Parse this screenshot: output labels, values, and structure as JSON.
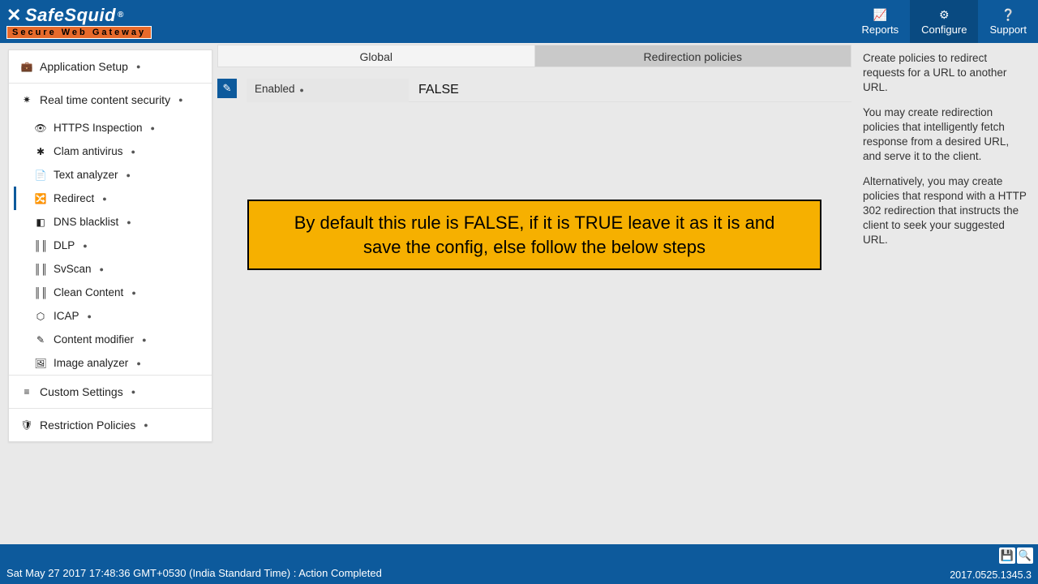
{
  "header": {
    "logo_main": "SafeSquid",
    "logo_reg": "®",
    "logo_sub": "Secure Web Gateway",
    "menu": {
      "reports": "Reports",
      "configure": "Configure",
      "support": "Support"
    }
  },
  "sidebar": {
    "app_setup": "Application Setup",
    "rtcs": "Real time content security",
    "items": {
      "https": "HTTPS Inspection",
      "clam": "Clam antivirus",
      "text": "Text analyzer",
      "redirect": "Redirect",
      "dns": "DNS blacklist",
      "dlp": "DLP",
      "svscan": "SvScan",
      "clean": "Clean Content",
      "icap": "ICAP",
      "contentmod": "Content modifier",
      "image": "Image analyzer"
    },
    "custom": "Custom Settings",
    "restriction": "Restriction Policies"
  },
  "tabs": {
    "global": "Global",
    "redir": "Redirection policies"
  },
  "form": {
    "enabled_label": "Enabled",
    "enabled_value": "FALSE"
  },
  "callout": "By default this rule is FALSE, if it is TRUE leave it as it is and save the config, else follow the below steps",
  "help": {
    "p1": "Create policies to redirect requests for a URL to another URL.",
    "p2": "You may create redirection policies that intelligently fetch response from a desired URL, and serve it to the client.",
    "p3": "Alternatively, you may create policies that respond with a HTTP 302 redirection that instructs the client to seek your suggested URL."
  },
  "footer": {
    "status": "Sat May 27 2017 17:48:36 GMT+0530 (India Standard Time) : Action Completed",
    "version": "2017.0525.1345.3"
  }
}
